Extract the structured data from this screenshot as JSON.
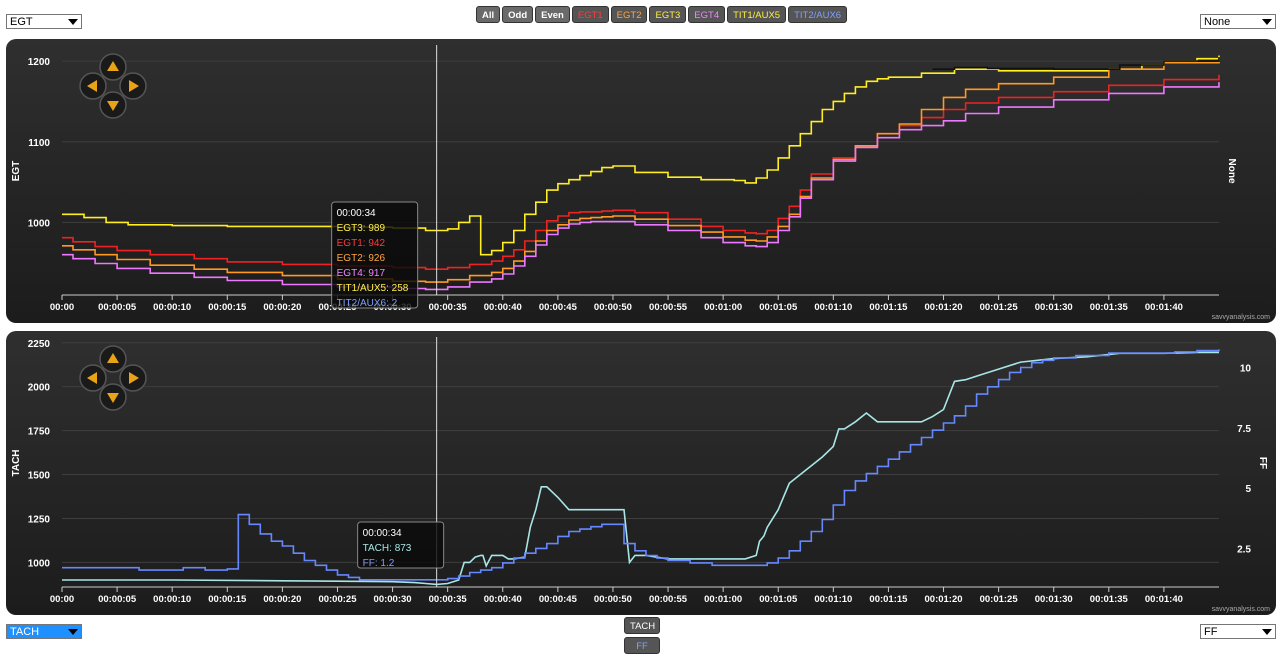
{
  "top_controls": {
    "left_select": "EGT",
    "right_select": "None",
    "buttons": [
      {
        "label": "All",
        "color": "#ffffff"
      },
      {
        "label": "Odd",
        "color": "#ffffff"
      },
      {
        "label": "Even",
        "color": "#ffffff"
      },
      {
        "label": "EGT1",
        "color": "#ff3b3b"
      },
      {
        "label": "EGT2",
        "color": "#ffa640"
      },
      {
        "label": "EGT3",
        "color": "#ffee44"
      },
      {
        "label": "EGT4",
        "color": "#ee88ff"
      },
      {
        "label": "TIT1/AUX5",
        "color": "#ffee44"
      },
      {
        "label": "TIT2/AUX6",
        "color": "#7f9fff"
      }
    ]
  },
  "bottom_controls": {
    "left_select": "TACH",
    "right_select": "FF",
    "buttons": [
      "TACH",
      "FF"
    ]
  },
  "watermark": "savvyanalysis.com",
  "chart_data": [
    {
      "type": "line",
      "ylabel": "EGT",
      "y2label": "None",
      "ylim": [
        910,
        1215
      ],
      "yticks": [
        1000,
        1100,
        1200
      ],
      "xlim": [
        0,
        105
      ],
      "xticks": [
        "00:00",
        "00:00:05",
        "00:00:10",
        "00:00:15",
        "00:00:20",
        "00:00:25",
        "00:00:30",
        "00:00:35",
        "00:00:40",
        "00:00:45",
        "00:00:50",
        "00:00:55",
        "00:01:00",
        "00:01:05",
        "00:01:10",
        "00:01:15",
        "00:01:20",
        "00:01:25",
        "00:01:30",
        "00:01:35",
        "00:01:40"
      ],
      "cursor_x": 34,
      "tooltip": {
        "time": "00:00:34",
        "rows": [
          {
            "label": "EGT3",
            "value": "989",
            "color": "#ffee44"
          },
          {
            "label": "EGT1",
            "value": "942",
            "color": "#ff3b3b"
          },
          {
            "label": "EGT2",
            "value": "926",
            "color": "#ffa640"
          },
          {
            "label": "EGT4",
            "value": "917",
            "color": "#ee88ff"
          },
          {
            "label": "TIT1/AUX5",
            "value": "258",
            "color": "#ffee44"
          },
          {
            "label": "TIT2/AUX6",
            "value": "2",
            "color": "#7f9fff"
          }
        ]
      },
      "series": [
        {
          "name": "EGT3",
          "color": "#ffee22",
          "step": true,
          "x": [
            0,
            2,
            4,
            6,
            10,
            15,
            20,
            25,
            30,
            33,
            35,
            36,
            37,
            38,
            39,
            40,
            41,
            42,
            43,
            44,
            45,
            46,
            47,
            48,
            49,
            50,
            52,
            55,
            58,
            61,
            62,
            63,
            64,
            65,
            66,
            67,
            68,
            69,
            70,
            71,
            72,
            73,
            74,
            75,
            78,
            81,
            84,
            85,
            90,
            95,
            98,
            100,
            103,
            105
          ],
          "y": [
            1010,
            1006,
            1000,
            997,
            996,
            995,
            995,
            994,
            993,
            990,
            992,
            1000,
            1008,
            960,
            965,
            975,
            990,
            1010,
            1025,
            1040,
            1048,
            1053,
            1058,
            1063,
            1068,
            1070,
            1062,
            1056,
            1053,
            1052,
            1049,
            1055,
            1065,
            1080,
            1095,
            1110,
            1125,
            1140,
            1150,
            1160,
            1168,
            1175,
            1178,
            1180,
            1185,
            1190,
            1190,
            1188,
            1188,
            1190,
            1195,
            1200,
            1203,
            1207
          ]
        },
        {
          "name": "EGT1",
          "color": "#ee2222",
          "step": true,
          "x": [
            0,
            1,
            3,
            5,
            8,
            12,
            15,
            20,
            25,
            30,
            33,
            35,
            37,
            39,
            40,
            41,
            42,
            43,
            44,
            45,
            46,
            47,
            48,
            49,
            50,
            52,
            55,
            58,
            60,
            62,
            63,
            64,
            65,
            66,
            67,
            68,
            70,
            72,
            74,
            76,
            78,
            80,
            82,
            85,
            90,
            95,
            100,
            105
          ],
          "y": [
            981,
            976,
            970,
            965,
            960,
            955,
            951,
            948,
            946,
            944,
            942,
            944,
            948,
            952,
            958,
            966,
            977,
            990,
            1002,
            1008,
            1012,
            1013,
            1013,
            1014,
            1015,
            1012,
            1004,
            995,
            990,
            987,
            986,
            990,
            1005,
            1020,
            1040,
            1060,
            1080,
            1095,
            1110,
            1120,
            1130,
            1140,
            1148,
            1155,
            1162,
            1170,
            1177,
            1183
          ]
        },
        {
          "name": "EGT2",
          "color": "#ff9922",
          "step": true,
          "x": [
            0,
            1,
            3,
            5,
            8,
            12,
            15,
            20,
            25,
            30,
            33,
            35,
            37,
            39,
            40,
            41,
            42,
            43,
            44,
            45,
            46,
            47,
            48,
            49,
            50,
            52,
            55,
            58,
            60,
            62,
            63,
            64,
            65,
            66,
            67,
            68,
            70,
            72,
            74,
            76,
            78,
            80,
            82,
            85,
            90,
            95,
            100,
            105
          ],
          "y": [
            971,
            966,
            960,
            954,
            947,
            942,
            938,
            934,
            930,
            927,
            926,
            929,
            934,
            938,
            943,
            952,
            964,
            977,
            990,
            997,
            1003,
            1005,
            1006,
            1007,
            1008,
            1004,
            996,
            988,
            982,
            978,
            977,
            982,
            995,
            1010,
            1032,
            1055,
            1078,
            1095,
            1110,
            1122,
            1140,
            1155,
            1165,
            1172,
            1180,
            1190,
            1198,
            1203
          ]
        },
        {
          "name": "EGT4",
          "color": "#ee77ff",
          "step": true,
          "x": [
            0,
            1,
            3,
            5,
            8,
            12,
            15,
            20,
            25,
            30,
            33,
            35,
            37,
            39,
            40,
            41,
            42,
            43,
            44,
            45,
            46,
            47,
            48,
            49,
            50,
            52,
            55,
            58,
            60,
            62,
            63,
            64,
            65,
            66,
            67,
            68,
            70,
            72,
            74,
            76,
            78,
            80,
            82,
            85,
            90,
            95,
            100,
            105
          ],
          "y": [
            960,
            955,
            949,
            943,
            937,
            932,
            928,
            923,
            920,
            918,
            917,
            920,
            926,
            930,
            936,
            946,
            958,
            972,
            985,
            993,
            998,
            1000,
            1001,
            1001,
            1001,
            997,
            990,
            981,
            975,
            971,
            970,
            975,
            990,
            1007,
            1030,
            1053,
            1076,
            1093,
            1105,
            1115,
            1120,
            1126,
            1135,
            1143,
            1152,
            1160,
            1168,
            1174
          ]
        },
        {
          "name": "TIT1/AUX5",
          "color": "#111111",
          "step": true,
          "x": [
            79,
            81,
            84,
            90,
            96,
            100,
            105
          ],
          "y": [
            1190,
            1192,
            1191,
            1190,
            1195,
            1200,
            1205
          ]
        }
      ]
    },
    {
      "type": "line",
      "ylabel": "TACH",
      "y2label": "FF",
      "ylim": [
        860,
        2260
      ],
      "yticks": [
        1000,
        1250,
        1500,
        1750,
        2000,
        2250
      ],
      "y2lim": [
        0.9,
        11.1
      ],
      "y2ticks": [
        2.5,
        5,
        7.5,
        10
      ],
      "xlim": [
        0,
        105
      ],
      "xticks": [
        "00:00",
        "00:00:05",
        "00:00:10",
        "00:00:15",
        "00:00:20",
        "00:00:25",
        "00:00:30",
        "00:00:35",
        "00:00:40",
        "00:00:45",
        "00:00:50",
        "00:00:55",
        "00:01:00",
        "00:01:05",
        "00:01:10",
        "00:01:15",
        "00:01:20",
        "00:01:25",
        "00:01:30",
        "00:01:35",
        "00:01:40"
      ],
      "cursor_x": 34,
      "tooltip": {
        "time": "00:00:34",
        "rows": [
          {
            "label": "TACH",
            "value": "873",
            "color": "#a8e6e6"
          },
          {
            "label": "FF",
            "value": "1.2",
            "color": "#7f9fff"
          }
        ]
      },
      "series": [
        {
          "name": "TACH",
          "color": "#a8e6e6",
          "axis": "left",
          "step": false,
          "x": [
            0,
            10,
            20,
            25,
            30,
            32,
            33,
            34,
            35,
            36,
            36.5,
            37,
            37.5,
            38,
            38.2,
            38.5,
            39,
            40,
            40.5,
            41,
            42,
            42,
            42.5,
            43,
            43.5,
            44,
            45,
            46,
            48,
            50,
            51,
            51.2,
            51.5,
            52,
            53,
            55,
            57,
            60,
            62,
            63,
            63.3,
            63.7,
            64,
            65,
            66,
            67,
            68,
            69,
            70,
            70.5,
            71,
            72,
            73,
            74,
            75,
            77,
            78,
            79,
            80,
            81,
            82,
            83,
            84,
            85,
            87,
            90,
            93,
            96,
            100,
            103,
            105
          ],
          "y": [
            900,
            900,
            895,
            893,
            890,
            885,
            880,
            875,
            880,
            900,
            1000,
            1000,
            1030,
            1040,
            1040,
            980,
            1040,
            1040,
            1020,
            1020,
            1030,
            1030,
            1200,
            1300,
            1430,
            1430,
            1370,
            1300,
            1300,
            1300,
            1300,
            1180,
            1000,
            1040,
            1040,
            1020,
            1020,
            1020,
            1020,
            1040,
            1120,
            1150,
            1200,
            1300,
            1450,
            1500,
            1550,
            1600,
            1660,
            1760,
            1760,
            1800,
            1850,
            1800,
            1800,
            1800,
            1800,
            1830,
            1870,
            2030,
            2040,
            2060,
            2080,
            2100,
            2140,
            2160,
            2170,
            2190,
            2190,
            2195,
            2195
          ]
        },
        {
          "name": "FF",
          "color": "#6688ff",
          "axis": "right",
          "step": true,
          "x": [
            0,
            5,
            7,
            9,
            11,
            13,
            15,
            16,
            17,
            18,
            19,
            20,
            21,
            22,
            23,
            24,
            25,
            26,
            27,
            28,
            29,
            30,
            31,
            32,
            33,
            34,
            35,
            36,
            37,
            38,
            39,
            40,
            41,
            42,
            43,
            44,
            45,
            46,
            47,
            48,
            49,
            50,
            51,
            52,
            53,
            54,
            55,
            57,
            59,
            61,
            63,
            64,
            65,
            66,
            67,
            68,
            69,
            70,
            71,
            72,
            73,
            74,
            75,
            76,
            77,
            78,
            79,
            80,
            81,
            82,
            83,
            84,
            85,
            86,
            87,
            88,
            89,
            90,
            92,
            95,
            98,
            101,
            103,
            105
          ],
          "y": [
            1.7,
            1.7,
            1.6,
            1.6,
            1.7,
            1.6,
            1.65,
            3.9,
            3.5,
            3.1,
            2.8,
            2.6,
            2.3,
            2.0,
            1.8,
            1.6,
            1.4,
            1.3,
            1.2,
            1.2,
            1.2,
            1.2,
            1.2,
            1.2,
            1.2,
            1.2,
            1.25,
            1.35,
            1.5,
            1.6,
            1.7,
            1.9,
            2.1,
            2.3,
            2.5,
            2.7,
            3.0,
            3.2,
            3.3,
            3.4,
            3.5,
            3.5,
            2.7,
            2.4,
            2.2,
            2.1,
            2.0,
            1.9,
            1.8,
            1.8,
            1.8,
            1.9,
            2.1,
            2.4,
            2.8,
            3.2,
            3.7,
            4.3,
            4.9,
            5.3,
            5.6,
            5.9,
            6.2,
            6.5,
            6.8,
            7.1,
            7.4,
            7.7,
            8.0,
            8.4,
            8.9,
            9.2,
            9.5,
            9.8,
            10.0,
            10.2,
            10.3,
            10.4,
            10.5,
            10.6,
            10.6,
            10.65,
            10.7,
            10.75
          ]
        }
      ]
    }
  ]
}
